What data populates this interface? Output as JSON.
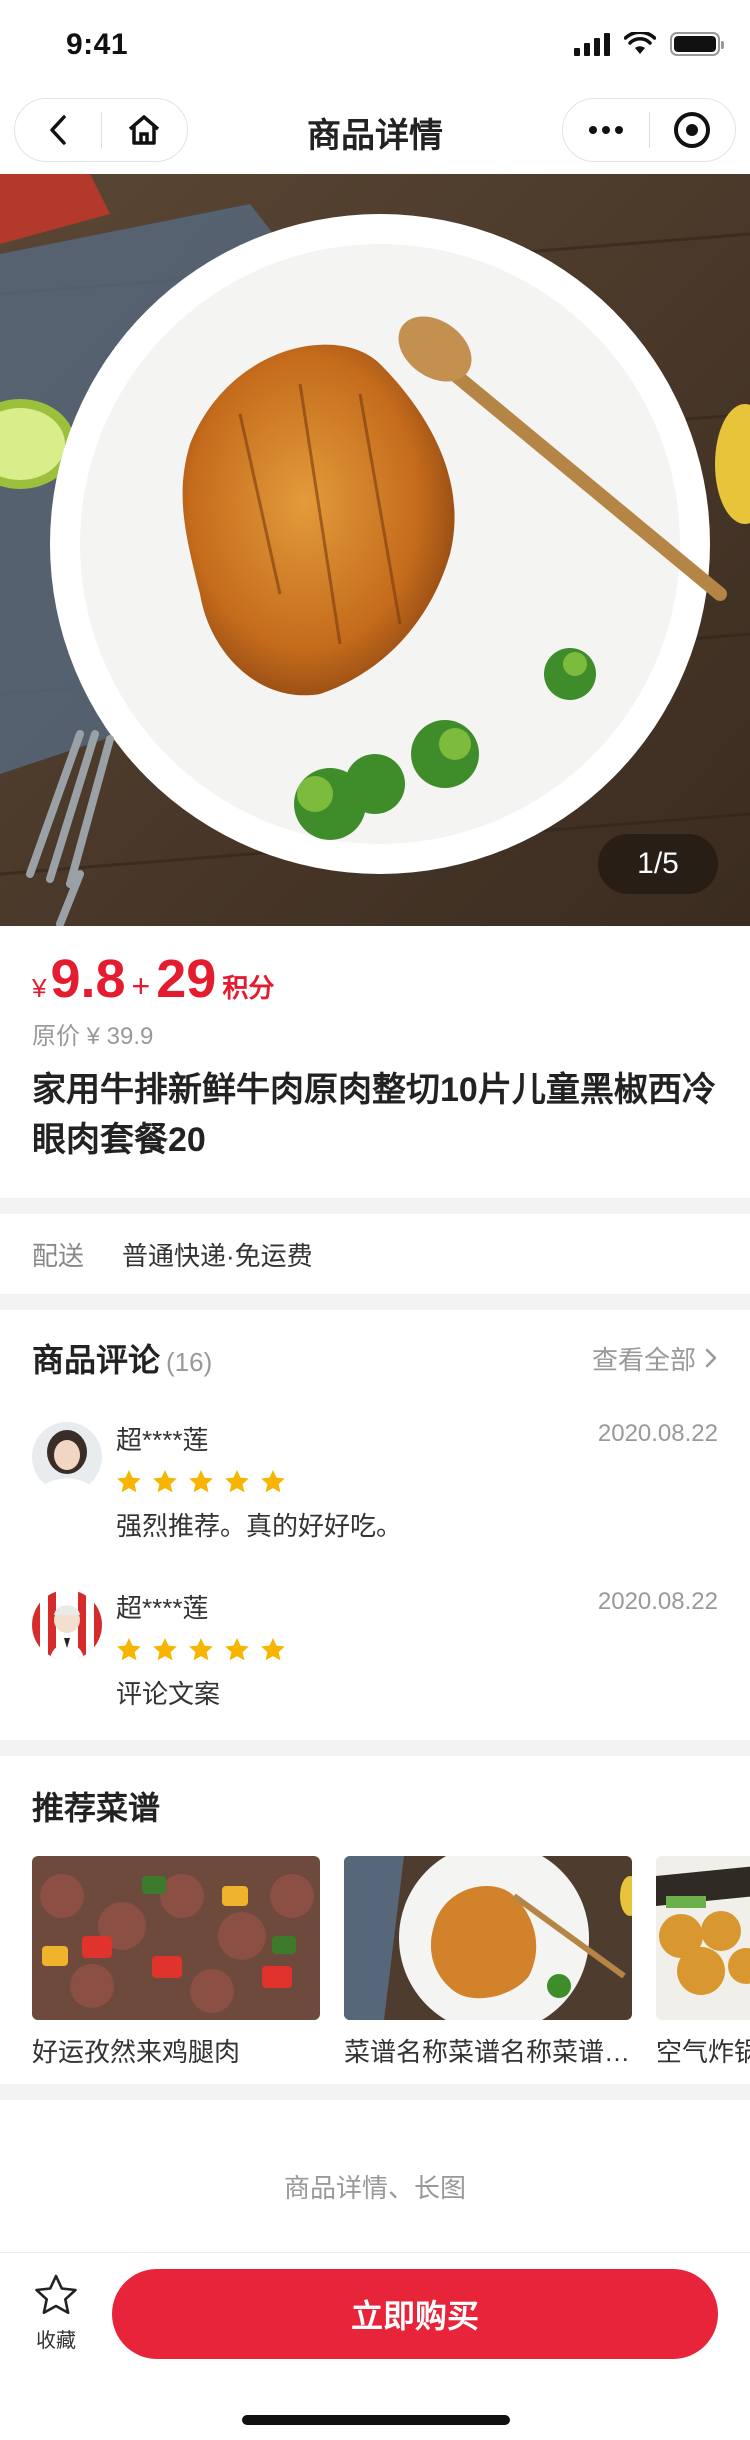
{
  "status_bar": {
    "time": "9:41"
  },
  "nav": {
    "title": "商品详情"
  },
  "hero": {
    "pager": "1/5",
    "image": "grilled-steak-with-broccoli"
  },
  "product": {
    "currency": "¥",
    "price": "9.8",
    "plus": "+",
    "points": "29",
    "points_label": "积分",
    "original_price": "原价 ¥ 39.9",
    "title": "家用牛排新鲜牛肉原肉整切10片儿童黑椒西冷眼肉套餐20"
  },
  "delivery": {
    "label": "配送",
    "value": "普通快递·免运费"
  },
  "comments": {
    "title": "商品评论",
    "count": "(16)",
    "view_all": "查看全部",
    "items": [
      {
        "user": "超****莲",
        "date": "2020.08.22",
        "rating": 5,
        "text": "强烈推荐。真的好好吃。"
      },
      {
        "user": "超****莲",
        "date": "2020.08.22",
        "rating": 5,
        "text": "评论文案"
      }
    ]
  },
  "recipes": {
    "title": "推荐菜谱",
    "items": [
      {
        "name": "好运孜然来鸡腿肉"
      },
      {
        "name": "菜谱名称菜谱名称菜谱名称"
      },
      {
        "name": "空气炸锅"
      }
    ]
  },
  "detail": {
    "placeholder": "商品详情、长图"
  },
  "bottom_bar": {
    "favorite_label": "收藏",
    "buy_label": "立即购买"
  },
  "colors": {
    "accent": "#e31d2f",
    "button": "#e7243a",
    "star": "#f7b500"
  }
}
